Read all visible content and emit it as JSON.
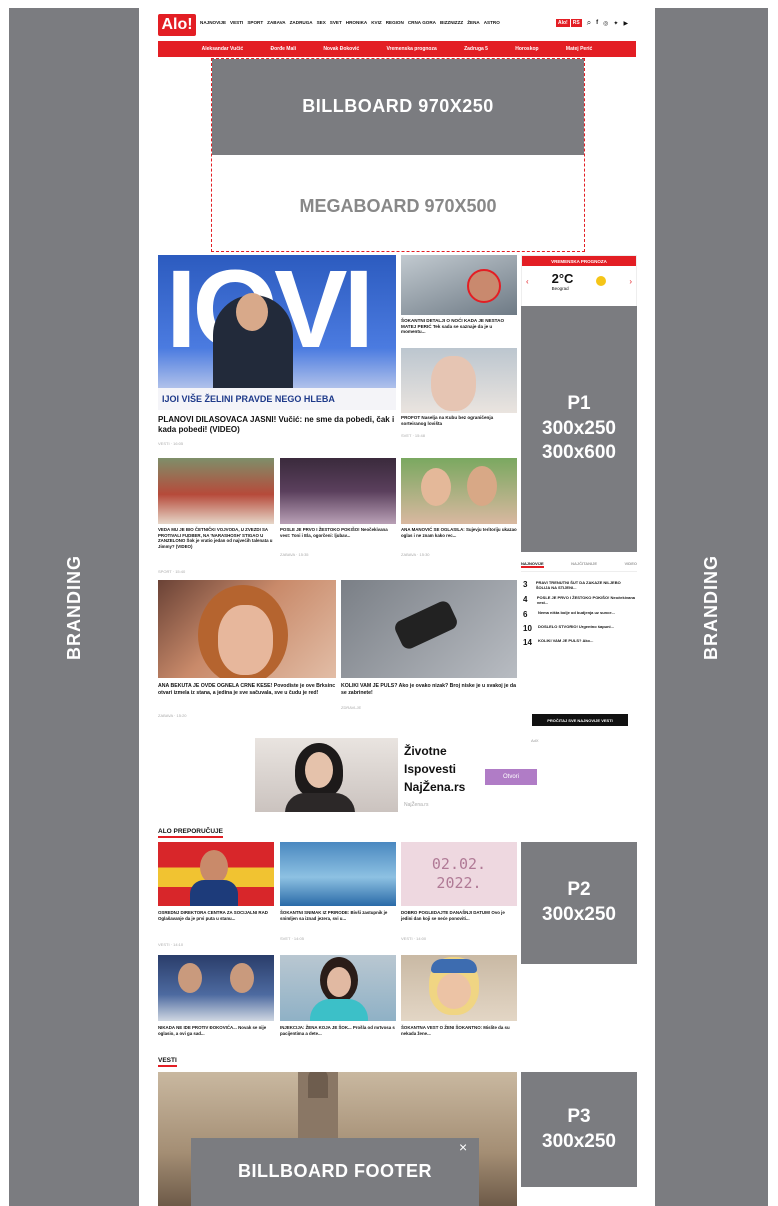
{
  "branding": {
    "left": "BRANDING",
    "right": "BRANDING"
  },
  "header": {
    "logo": "Alo!",
    "nav": [
      "NAJNOVIJE",
      "VESTI",
      "SPORT",
      "ZABAVA",
      "ZADRUGA",
      "SEX",
      "SVET",
      "HRONIKA",
      "KVIZ",
      "REGION",
      "CRNA GORA",
      "BIZZNIZZZ",
      "ŽENA",
      "ASTRO"
    ],
    "rs_badge": "RS",
    "red_bar_links": [
      "Aleksandar Vučić",
      "Đorđe Mali",
      "Novak Đoković",
      "Vremenska prognoza",
      "Zadruga 5",
      "Horoskop",
      "Matej Perić"
    ]
  },
  "ads": {
    "billboard": "BILLBOARD 970X250",
    "megaboard": "MEGABOARD 970X500",
    "p1": [
      "P1",
      "300x250",
      "300x600"
    ],
    "p2": [
      "P2",
      "300x250"
    ],
    "p3": [
      "P3",
      "300x250"
    ],
    "billboard_footer": "BILLBOARD FOOTER",
    "close": "×"
  },
  "weather": {
    "title": "VREMENSKA PROGNOZA",
    "temp": "2°C",
    "city": "Beograd"
  },
  "hero": {
    "banner_text": "IJOI VIŠE ŽELINI PRAVDE NEGO HLEBA",
    "headline": "PLANOVI DILASOVACA JASNI! Vučić: ne sme da pobedi, čak i kada pobedi! (VIDEO)",
    "meta": "VESTI · 16:05"
  },
  "side_news": [
    {
      "title": "ŠOKANTNI DETALJI O NOĆI KADA JE NESTAO MATEJ PERIĆ Tek sada se saznaje da je u momentu...",
      "meta": ""
    },
    {
      "title": "PROFOT Naselja na Kubu bez ograničenja sorteiranog lovišta",
      "meta": "SVET · 15:48"
    }
  ],
  "row_news": [
    {
      "title": "VEDA MU JE BIO ČETNIČKI VOJVODA, U ZVEZDI SA PROTIVALI FUDBER, NA 'NARASHOSH' STIGAO U ZANZELONO Šok je vratio jedan od najvećih talenata u Jimmy? (VIDEO)",
      "meta": "SPORT · 15:40"
    },
    {
      "title": "POSLE JE PRVO I ŽESTOKO POKIŠO! Neočekivana vest: Toni i Ela, ogorčeni: ljubav...",
      "meta": "ZABAVA · 15:35"
    },
    {
      "title": "ANA MANOVIĆ SE OGLASILA: Sujevju teritoriju ukazao oglas i ne znam kako rec...",
      "meta": "ZABAVA · 15:30"
    }
  ],
  "big_news": [
    {
      "title": "ANA BEKUTA JE OVDE OGNELA CRNE KESE! Povodiste je ove Brksinc otvari izmela iz stana, a jedina je sve sačuvala, sve u čudu je red!",
      "meta": "ZABAVA · 15:20"
    },
    {
      "title": "KOLIKI VAM JE PULS? Ako je ovako nizak? Broj niske je u svakoj je da se zabrinete!",
      "meta": "ZDRAVLJE"
    }
  ],
  "popular_tabs": [
    "NAJNOVIJE",
    "NAJČITANIJE",
    "VIDEO"
  ],
  "popular_list": [
    {
      "n": "3",
      "t": "PRAVI TRENUTNI ŠUT DA ZAKAZE NILJEBO ŠOLIJA NA STIJENI..."
    },
    {
      "n": "4",
      "t": "POSLE JE PRVO I ŽESTOKO POKIŠO! Neočekivana vest..."
    },
    {
      "n": "6",
      "t": "Nema ništa bolje od budjenja uz sunce..."
    },
    {
      "n": "10",
      "t": "DOSLELO STVORIO! Urgentno šapuni..."
    },
    {
      "n": "14",
      "t": "KOLIKI VAM JE PULS? Ako..."
    }
  ],
  "more_button": "PROČITAJ SVE NAJNOVIJE VESTI",
  "promo": {
    "title_lines": [
      "Životne",
      "Ispovesti",
      "NajŽena.rs"
    ],
    "source": "NajŽena.rs",
    "button": "Otvori"
  },
  "alo_recommends": {
    "heading": "ALO PREPORUČUJE",
    "items": [
      {
        "title": "OSREDNJ DIREKTORA CENTRA ZA SOCIJALNI RAD Oglašavanje da je prvi puta u stanu...",
        "meta": "VESTI · 14:10"
      },
      {
        "title": "ŠOKANTNI SNIMAK IZ PRIRODE: Bivši zastupnik je snimljen sa iznad jezera, svi u...",
        "meta": "SVET · 14:05"
      },
      {
        "title": "DOBRO POGLEDAJTE DANAŠNJI DATUM! Ovo je jedini dan koji se neće ponoviti...",
        "meta": "VESTI · 14:00"
      },
      {
        "title": "NIKADA NE IDE PROTIV ĐOKOVIĆA... Novak se nije oglasio, a ovi ga sad...",
        "meta": ""
      },
      {
        "title": "INJEKCIJA: ŽENA KOJA JE ŠOK... Prošla od mrtvosa s pacijentima a dete...",
        "meta": ""
      },
      {
        "title": "ŠOKANTNA VEST O ŽENI ŠOKANTNO: Mislite da su nekada žene...",
        "meta": ""
      }
    ],
    "date_text": "02.02. 2022."
  },
  "vesti_heading": "VESTI"
}
